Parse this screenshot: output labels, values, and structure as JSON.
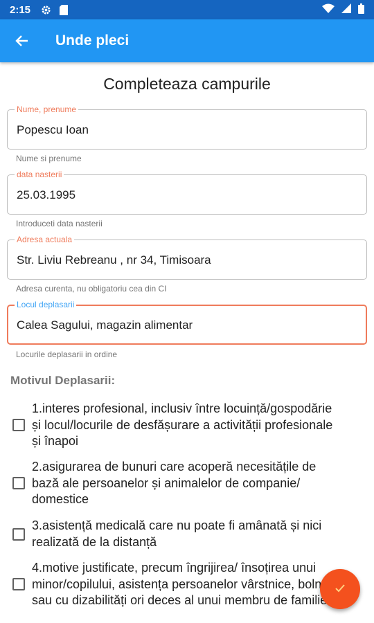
{
  "status_bar": {
    "time": "2:15",
    "icons": [
      "gear-icon",
      "sd-card-icon",
      "wifi-icon",
      "battery-icon"
    ]
  },
  "app_bar": {
    "title": "Unde pleci",
    "back_icon": "arrow-left-icon"
  },
  "heading": "Completeaza campurile",
  "fields": [
    {
      "label": "Nume, prenume",
      "value": "Popescu Ioan",
      "helper": "Nume si prenume",
      "label_color": "#ef7b5b"
    },
    {
      "label": "data nasterii",
      "value": "25.03.1995",
      "helper": "Introduceti data nasterii",
      "label_color": "#ef7b5b"
    },
    {
      "label": "Adresa actuala",
      "value": "Str. Liviu Rebreanu , nr 34, Timisoara",
      "helper": "Adresa curenta, nu obligatoriu cea din CI",
      "label_color": "#ef7b5b"
    },
    {
      "label": "Locul deplasarii",
      "value": "Calea Sagului, magazin alimentar",
      "helper": "Locurile deplasarii in ordine",
      "label_color": "#42a5f5"
    }
  ],
  "section_title": "Motivul Deplasarii:",
  "options": [
    {
      "checked": false,
      "lines": [
        "1.interes profesional, inclusiv între locuință/gospodărie",
        "și locul/locurile de desfășurare a activității profesionale",
        "și înapoi"
      ]
    },
    {
      "checked": false,
      "lines": [
        "2.asigurarea de bunuri care acoperă necesitățile de",
        "bază ale persoanelor și animalelor de companie/",
        "domestice"
      ]
    },
    {
      "checked": false,
      "lines": [
        "3.asistență medicală care nu poate fi amânată și nici",
        "realizată de la distanță"
      ]
    },
    {
      "checked": false,
      "lines": [
        "4.motive justificate, precum îngrijirea/ însoțirea unui",
        "minor/copilului, asistența persoanelor vârstnice, bolnave",
        "sau cu dizabilități ori deces al unui membru de familie"
      ]
    }
  ],
  "fab": {
    "icon": "check-icon",
    "color": "#f4511e"
  }
}
